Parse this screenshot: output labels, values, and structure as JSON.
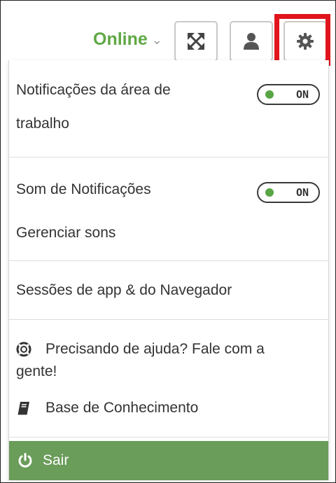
{
  "header": {
    "status_label": "Online",
    "status_color": "#5fa845",
    "buttons": [
      {
        "name": "expand",
        "icon": "expand-arrows-icon"
      },
      {
        "name": "user",
        "icon": "user-icon"
      },
      {
        "name": "settings",
        "icon": "gear-icon",
        "highlighted": true
      }
    ],
    "highlight_color": "#e0151e"
  },
  "menu": {
    "desktop_notifications": {
      "label_line1": "Notificações da área de",
      "label_line2": "trabalho",
      "toggle": "ON"
    },
    "notification_sound": {
      "label": "Som de Notificações",
      "toggle": "ON",
      "manage_label": "Gerenciar sons"
    },
    "sessions_label": "Sessões de app & do Navegador",
    "help": {
      "line1": "Precisando de ajuda? Fale com a",
      "line2": "gente!",
      "icon": "lifebuoy-icon"
    },
    "knowledge_base": {
      "label": "Base de Conhecimento",
      "icon": "book-icon"
    },
    "logout": {
      "label": "Sair",
      "icon": "power-icon",
      "background": "#6a9c5a"
    }
  }
}
